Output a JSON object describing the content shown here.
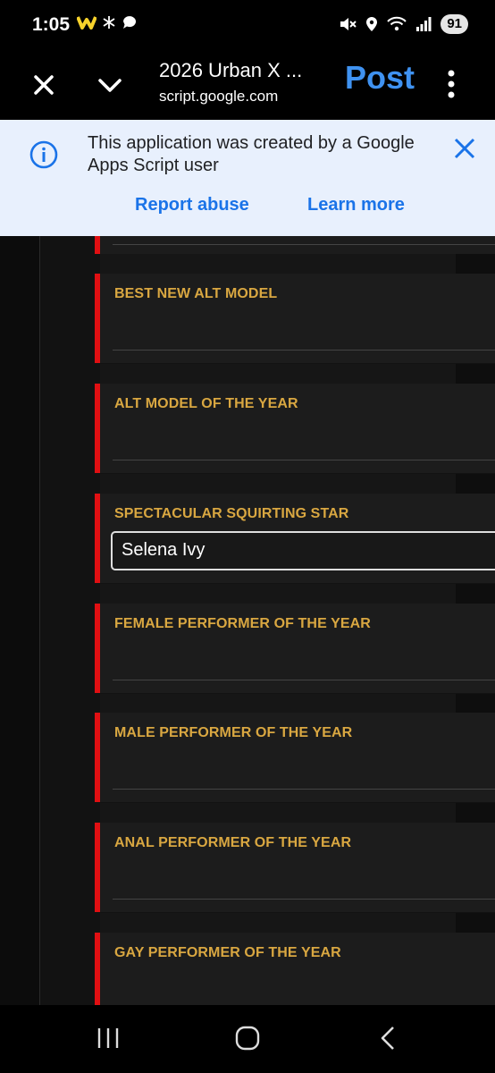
{
  "status_bar": {
    "time": "1:05",
    "battery": "91",
    "left_icons": [
      "notification-w-icon",
      "snowflake-icon",
      "chat-bubble-icon"
    ],
    "right_icons": [
      "mute-icon",
      "location-icon",
      "wifi-icon",
      "signal-icon"
    ]
  },
  "toolbar": {
    "title": "2026 Urban X ...",
    "url": "script.google.com",
    "post_label": "Post"
  },
  "banner": {
    "message": "This application was created by a Google Apps Script user",
    "report_label": "Report abuse",
    "learn_label": "Learn more"
  },
  "categories": [
    {
      "label": "BEST NEW ALT MODEL",
      "value": ""
    },
    {
      "label": "ALT MODEL OF THE YEAR",
      "value": ""
    },
    {
      "label": "SPECTACULAR SQUIRTING STAR",
      "value": "Selena Ivy"
    },
    {
      "label": "FEMALE PERFORMER OF THE YEAR",
      "value": ""
    },
    {
      "label": "MALE PERFORMER OF THE YEAR",
      "value": ""
    },
    {
      "label": "ANAL PERFORMER OF THE YEAR",
      "value": ""
    },
    {
      "label": "GAY PERFORMER OF THE YEAR",
      "value": ""
    }
  ],
  "colors": {
    "accent_red": "#e00f12",
    "label_gold": "#d9a741",
    "link_blue": "#1a73e8",
    "post_blue": "#3f92f1"
  }
}
